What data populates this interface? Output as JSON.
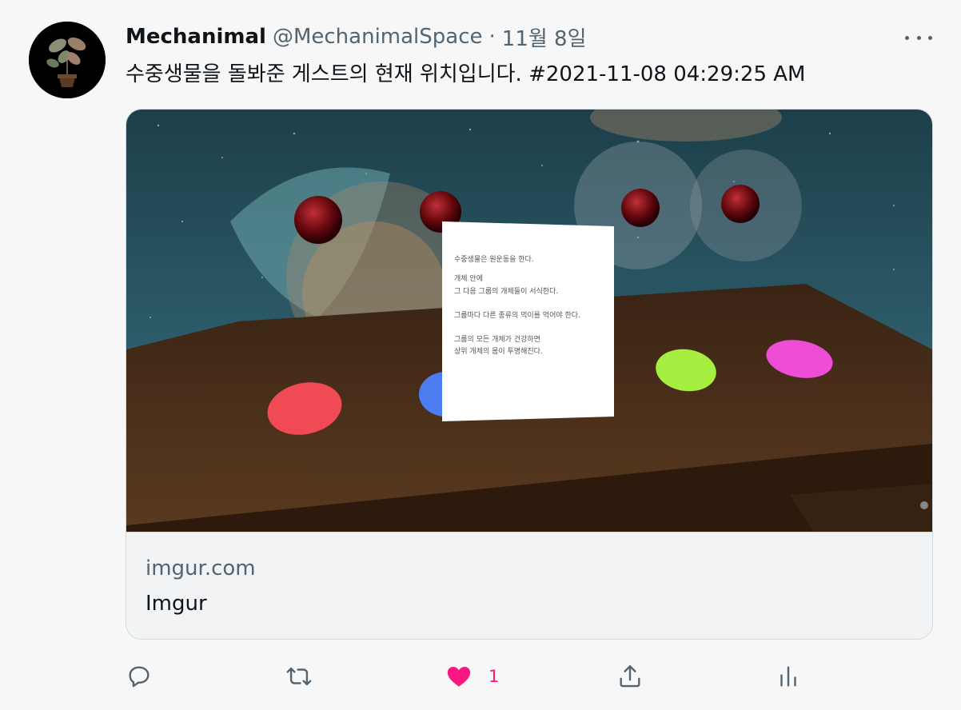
{
  "tweet": {
    "author_name": "Mechanimal",
    "author_handle": "@MechanimalSpace",
    "separator": "·",
    "date": "11월 8일",
    "text": "수중생물을 돌봐준 게스트의 현재 위치입니다. #2021-11-08 04:29:25 AM"
  },
  "card": {
    "domain": "imgur.com",
    "title": "Imgur",
    "note_lines": [
      "수중생물은 원운동을 한다.",
      "",
      "개체 안에",
      "그 다음 그룹의 개체들이 서식한다.",
      "",
      "그룹마다 다른 종류의 먹이를 먹어야 한다.",
      "",
      "그룹의 모든 개체가 건강하면",
      "상위 개체의 몸이 투명해진다."
    ]
  },
  "actions": {
    "reply_icon": "reply-icon",
    "retweet_icon": "retweet-icon",
    "like_icon": "heart-icon",
    "like_count": "1",
    "share_icon": "share-icon",
    "analytics_icon": "analytics-icon"
  },
  "colors": {
    "like_active": "#f91880",
    "secondary_text": "#536471",
    "primary_text": "#0f1419",
    "disc_red": "#f04a55",
    "disc_blue": "#4d7cf0",
    "disc_green": "#a6ee3f",
    "disc_magenta": "#ee4ed5"
  }
}
